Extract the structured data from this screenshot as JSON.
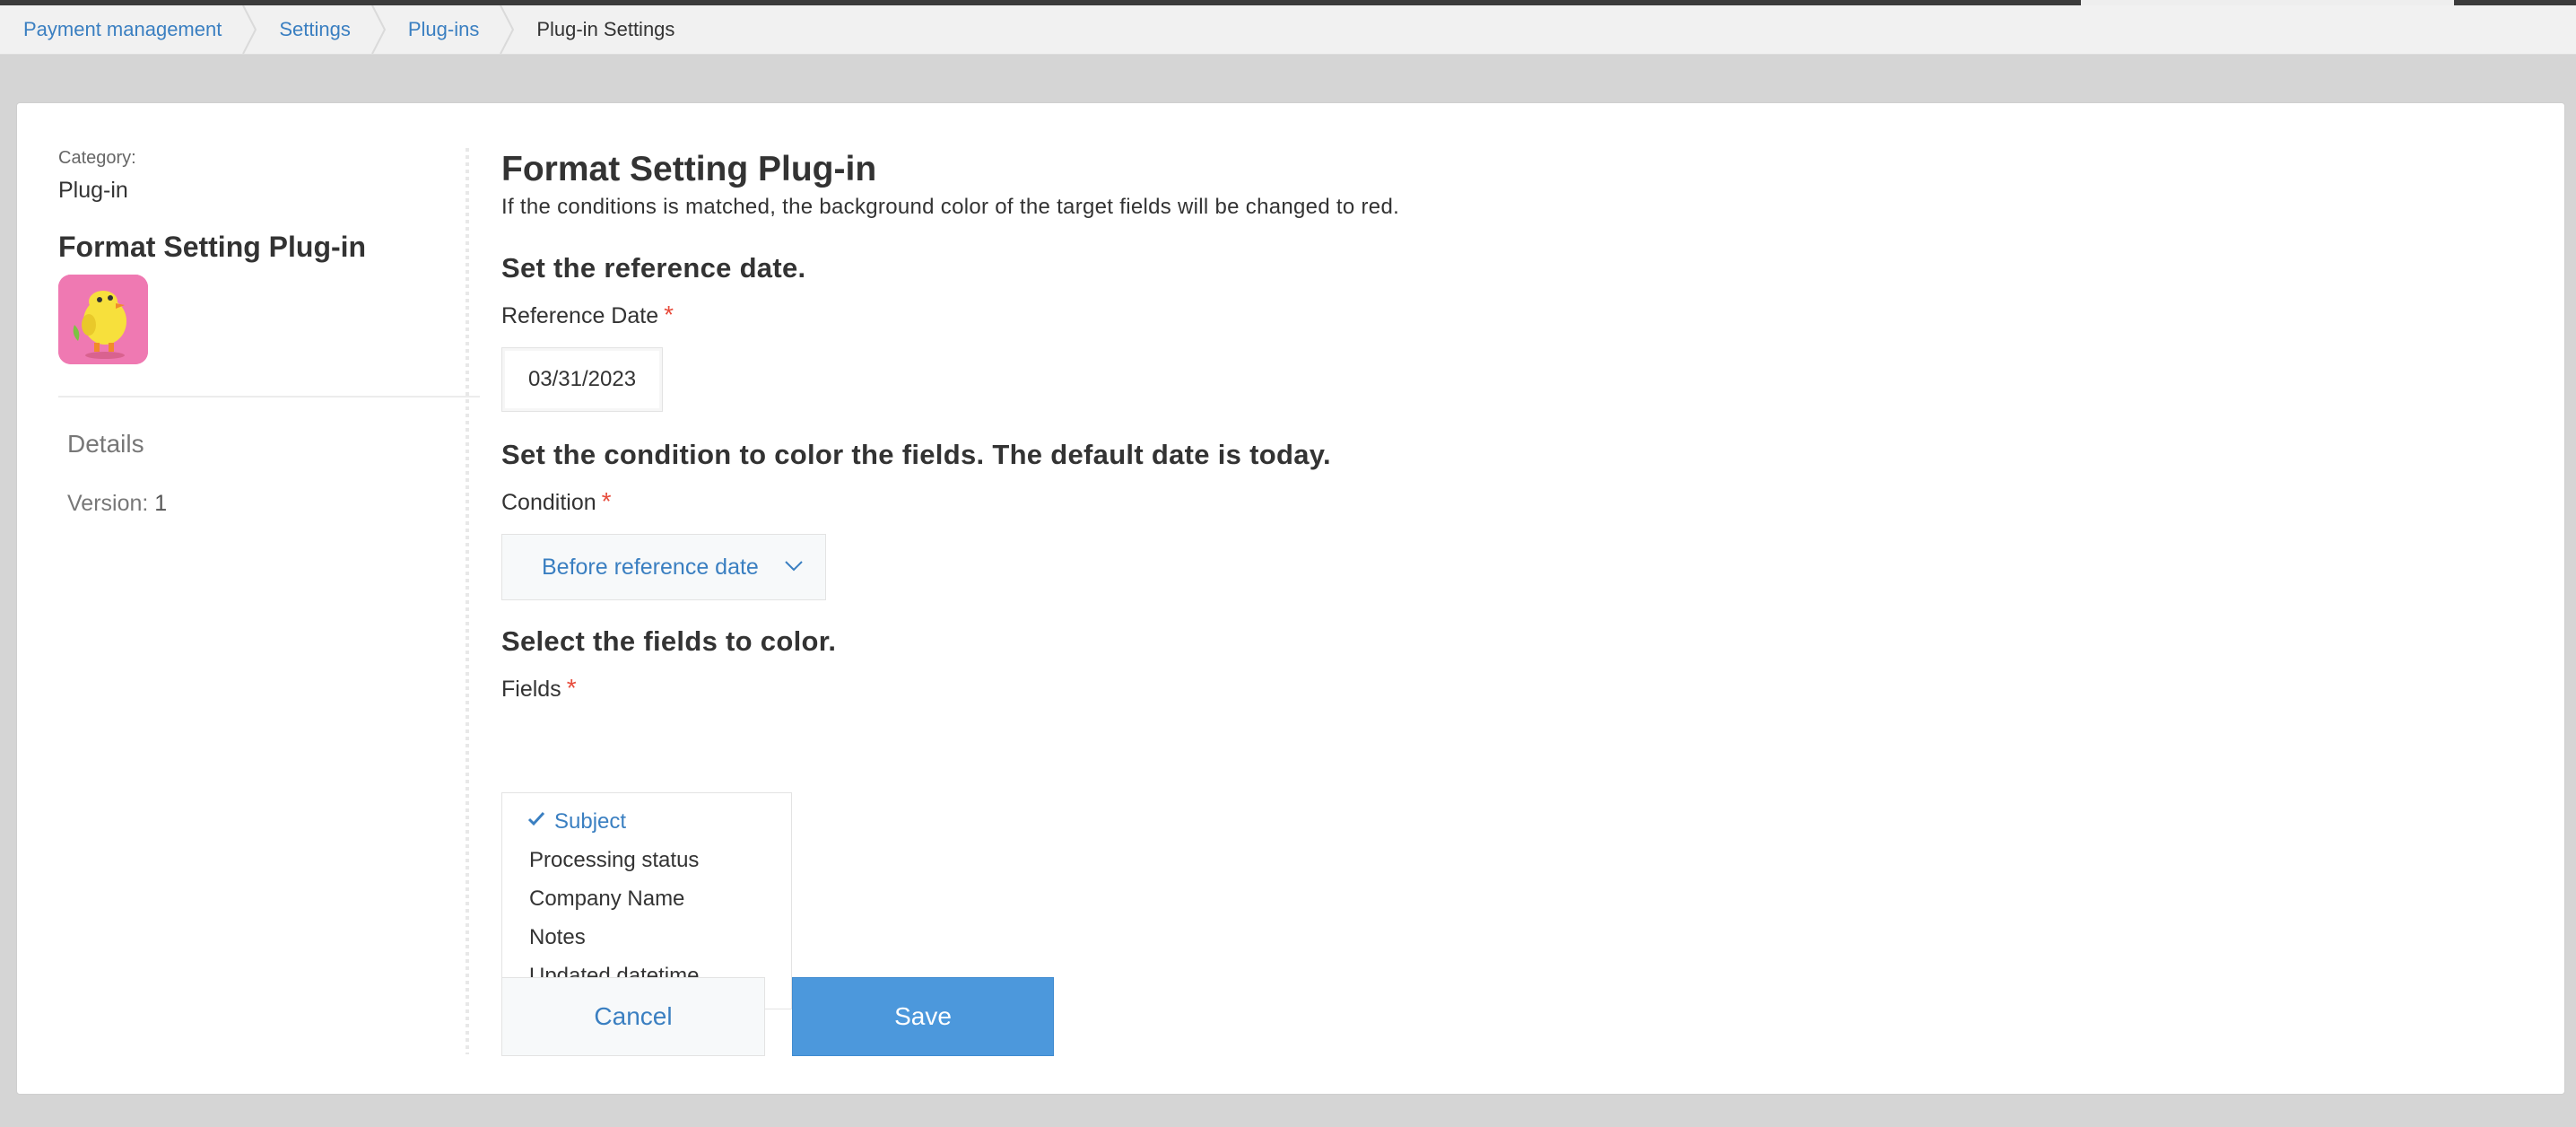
{
  "breadcrumb": [
    {
      "label": "Payment management",
      "current": false
    },
    {
      "label": "Settings",
      "current": false
    },
    {
      "label": "Plug-ins",
      "current": false
    },
    {
      "label": "Plug-in Settings",
      "current": true
    }
  ],
  "sidebar": {
    "category_label": "Category:",
    "category_value": "Plug-in",
    "plugin_name": "Format Setting Plug-in",
    "details_label": "Details",
    "version_label": "Version:",
    "version_value": "1"
  },
  "main": {
    "title": "Format Setting Plug-in",
    "description": "If the conditions is matched, the background color of the target fields will be changed to red.",
    "reference_section": {
      "heading": "Set the reference date.",
      "label": "Reference Date",
      "required_mark": "*",
      "value": "03/31/2023"
    },
    "condition_section": {
      "heading": "Set the condition to color the fields. The default date is today.",
      "label": "Condition",
      "required_mark": "*",
      "selected": "Before reference date"
    },
    "fields_section": {
      "heading": "Select the fields to color.",
      "label": "Fields",
      "required_mark": "*",
      "options": [
        {
          "label": "Subject",
          "selected": true
        },
        {
          "label": "Processing status",
          "selected": false
        },
        {
          "label": "Company Name",
          "selected": false
        },
        {
          "label": "Notes",
          "selected": false
        },
        {
          "label": "Updated datetime",
          "selected": false
        }
      ]
    },
    "buttons": {
      "cancel": "Cancel",
      "save": "Save"
    }
  },
  "colors": {
    "link": "#3a7fc1",
    "primary_button": "#4c98dc",
    "required": "#e74c3c",
    "icon_bg": "#ef79b2"
  },
  "icons": [
    "breadcrumb-separator-icon",
    "plugin-icon",
    "chevron-down-icon",
    "checkmark-icon"
  ]
}
